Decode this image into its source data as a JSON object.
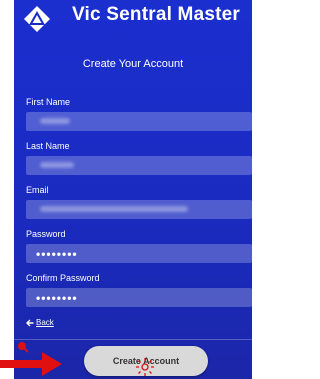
{
  "header": {
    "title": "Vic Sentral Master",
    "logo_icon": "app-logo-icon"
  },
  "form": {
    "title": "Create Your Account",
    "fields": [
      {
        "label": "First Name"
      },
      {
        "label": "Last Name"
      },
      {
        "label": "Email"
      },
      {
        "label": "Password",
        "value": "••••••••"
      },
      {
        "label": "Confirm Password",
        "value": "••••••••"
      }
    ],
    "back_label": "Back",
    "back_icon": "arrow-left-icon"
  },
  "actions": {
    "create_label": "Create Account"
  },
  "annotations": {
    "pointer_icon": "red-arrow-icon",
    "tap_icon": "tap-indicator-icon",
    "colors": {
      "annotation": "#e01010",
      "background": "#1b2fcf"
    }
  }
}
